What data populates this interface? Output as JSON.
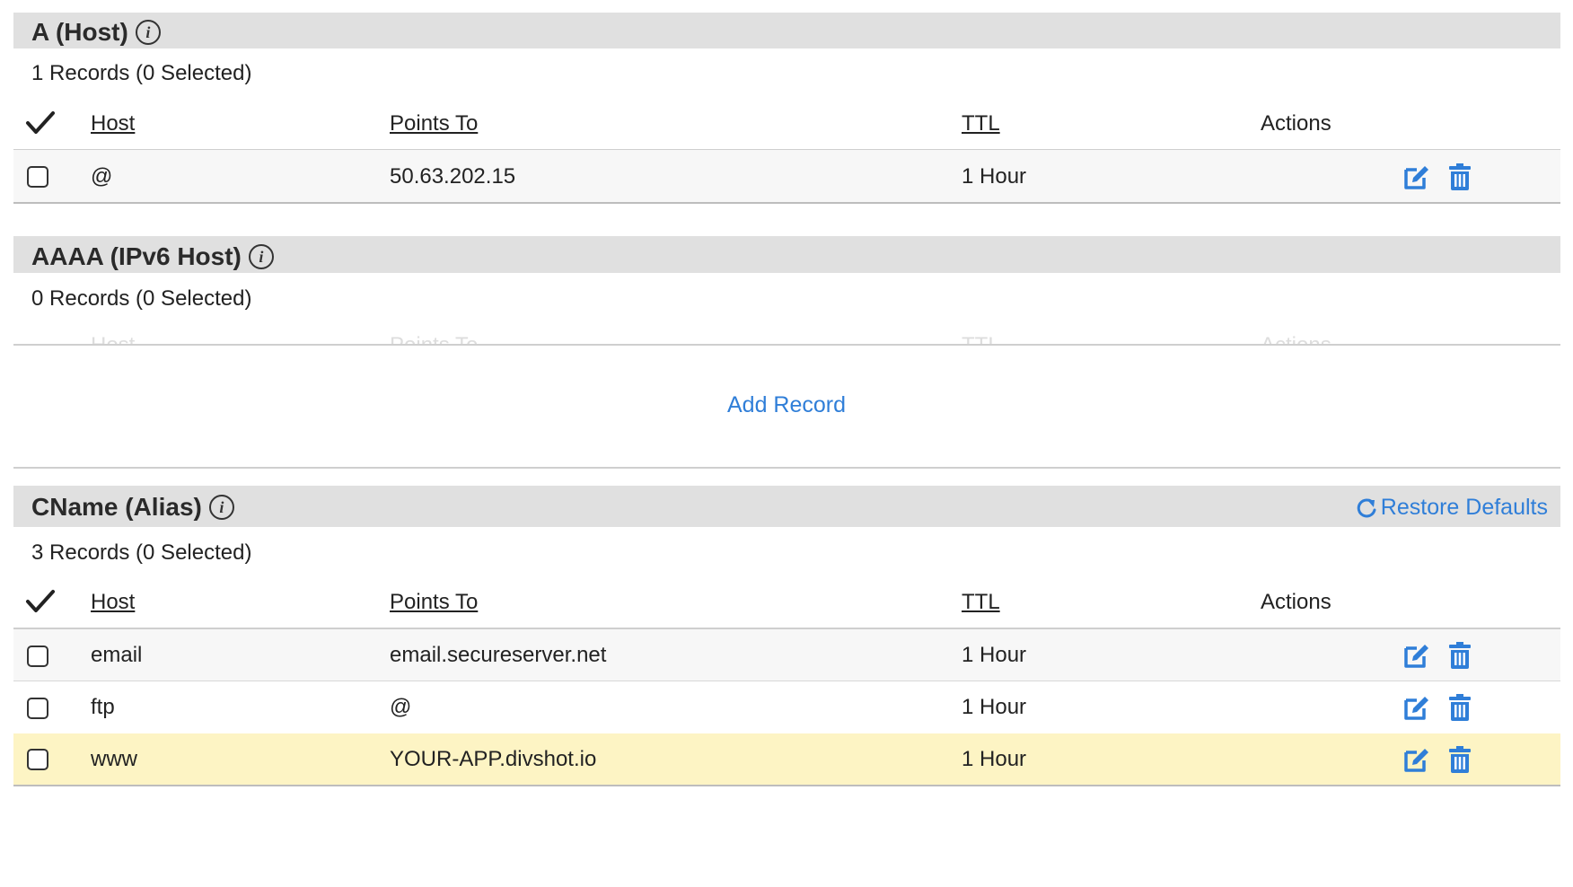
{
  "colors": {
    "accent": "#2f7ed8",
    "section_bar": "#e0e0e0",
    "row_alt": "#f7f7f7",
    "row_highlight": "#fdf4c4"
  },
  "icons": {
    "info": "info-icon",
    "check_all": "checkmark-icon",
    "edit": "edit-icon",
    "delete": "trash-icon",
    "restore": "refresh-icon"
  },
  "columns": {
    "host": "Host",
    "points_to": "Points To",
    "ttl": "TTL",
    "actions": "Actions"
  },
  "a_section": {
    "title": "A (Host)",
    "count": "1 Records (0 Selected)",
    "rows": [
      {
        "host": "@",
        "points_to": "50.63.202.15",
        "ttl": "1 Hour"
      }
    ]
  },
  "aaaa_section": {
    "title": "AAAA (IPv6 Host)",
    "count": "0 Records (0 Selected)",
    "add_record": "Add Record"
  },
  "cname_section": {
    "title": "CName (Alias)",
    "count": "3 Records (0 Selected)",
    "restore_defaults": "Restore Defaults",
    "rows": [
      {
        "host": "email",
        "points_to": "email.secureserver.net",
        "ttl": "1 Hour"
      },
      {
        "host": "ftp",
        "points_to": "@",
        "ttl": "1 Hour"
      },
      {
        "host": "www",
        "points_to": "YOUR-APP.divshot.io",
        "ttl": "1 Hour"
      }
    ]
  }
}
